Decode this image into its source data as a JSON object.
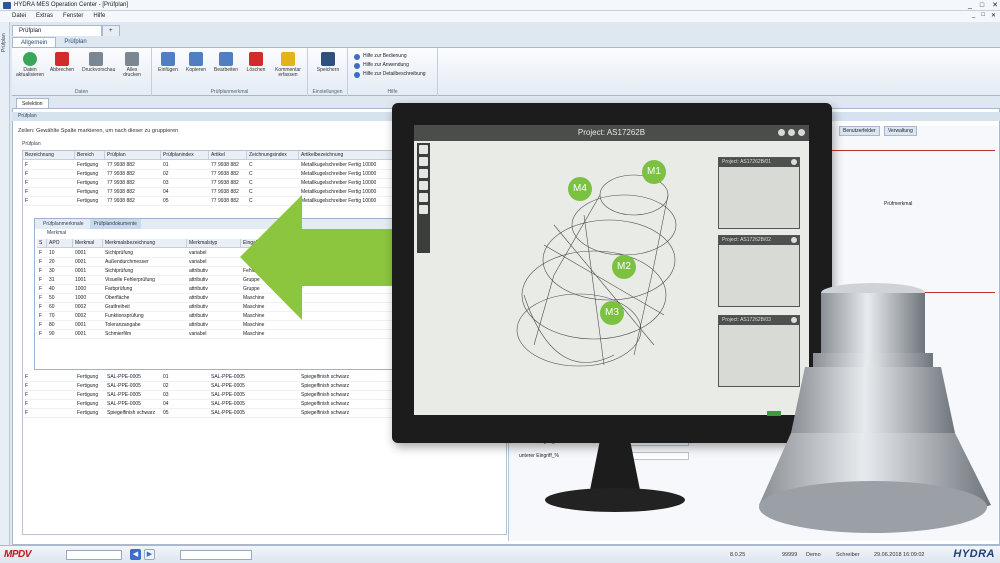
{
  "window": {
    "title": "HYDRA MES Operation Center - [Prüfplan]",
    "min": "_",
    "max": "□",
    "close": "✕"
  },
  "menu": [
    "Datei",
    "Extras",
    "Fenster",
    "Hilfe"
  ],
  "left_tab": "Prüfplan",
  "doc_tabs": [
    "Prüfplan",
    "+"
  ],
  "ribbon": {
    "tabs": [
      "Allgemein",
      "Prüfplan"
    ],
    "groups": [
      {
        "label": "Daten",
        "buttons": [
          "Daten aktualisieren",
          "Abbrechen",
          "Druckvorschau",
          "Alles drucken"
        ]
      },
      {
        "label": "Prüfplanmerkmal",
        "buttons": [
          "Einfügen",
          "Kopieren",
          "Bearbeiten",
          "Löschen",
          "Kommentar erfassen"
        ]
      },
      {
        "label": "Einstellungen",
        "buttons": [
          "Speichern"
        ]
      },
      {
        "label": "Hilfe",
        "links": [
          "Hilfe zur Bedienung",
          "Hilfe zur Anwendung",
          "Hilfe zur Detailbeschreibung"
        ]
      }
    ],
    "colors": {
      "refresh": "#3aa657",
      "cancel": "#d32b2b",
      "print": "#7b8693",
      "doc": "#4f7fc2",
      "yellow": "#e3b31b",
      "save": "#2f4f7f"
    }
  },
  "selection_tab": "Selektion",
  "section_bar": "Prüfplan",
  "hint": "Zeilen: Gewählte Spalte markieren, um nach dieser zu gruppieren",
  "table_caption": "Prüfplan",
  "columns": [
    "Bezeichnung",
    "Bereich",
    "Prüfplan",
    "Prüfplanindex",
    "Artikel",
    "Zeichnungsindex",
    "Artikelbezeichnung"
  ],
  "rows_top": [
    [
      "F",
      "Fertigung",
      "77 9938 882",
      "01",
      "77 9938 882",
      "C",
      "Metallkugelschreiber Fertig 10000"
    ],
    [
      "F",
      "Fertigung",
      "77 9938 882",
      "02",
      "77 9938 882",
      "C",
      "Metallkugelschreiber Fertig 10000"
    ],
    [
      "F",
      "Fertigung",
      "77 9938 882",
      "03",
      "77 9938 882",
      "C",
      "Metallkugelschreiber Fertig 10000"
    ],
    [
      "F",
      "Fertigung",
      "77 9938 882",
      "04",
      "77 9938 882",
      "C",
      "Metallkugelschreiber Fertig 10000"
    ],
    [
      "F",
      "Fertigung",
      "77 9938 882",
      "05",
      "77 9938 882",
      "C",
      "Metallkugelschreiber Fertig 10000"
    ]
  ],
  "sub_tabs": [
    "Prüfplanmerkmale",
    "Prüfplandokumente"
  ],
  "sub_caption": "Merkmal",
  "sub_columns": [
    "S",
    "APO",
    "Merkmal",
    "Merkmalsbezeichnung",
    "Merkmalstyp",
    "Eingabe"
  ],
  "sub_rows": [
    [
      "F",
      "10",
      "0001",
      "Sichtprüfung",
      "variabel",
      ""
    ],
    [
      "F",
      "20",
      "0001",
      "Außendurchmesser",
      "variabel",
      ""
    ],
    [
      "F",
      "30",
      "0001",
      "Sichtprüfung",
      "attributiv",
      "Fehlermerkmale"
    ],
    [
      "F",
      "31",
      "1001",
      "Visuelle Fehlerprüfung",
      "attributiv",
      "Gruppe"
    ],
    [
      "F",
      "40",
      "1000",
      "Farbprüfung",
      "attributiv",
      "Gruppe"
    ],
    [
      "F",
      "50",
      "1000",
      "Oberfläche",
      "attributiv",
      "Maschine"
    ],
    [
      "F",
      "60",
      "0002",
      "Gratfreiheit",
      "attributiv",
      "Maschine"
    ],
    [
      "F",
      "70",
      "0002",
      "Funktionsprüfung",
      "attributiv",
      "Maschine"
    ],
    [
      "F",
      "80",
      "0001",
      "Toleranzangabe",
      "attributiv",
      "Maschine"
    ],
    [
      "F",
      "90",
      "0001",
      "Schmierfilm",
      "variabel",
      "Maschine"
    ]
  ],
  "rows_bottom": [
    [
      "F",
      "Fertigung",
      "SAL-PPE-0005",
      "01",
      "SAL-PPE-0005",
      "",
      "Spiegelfinish schwarz"
    ],
    [
      "F",
      "Fertigung",
      "SAL-PPE-0005",
      "02",
      "SAL-PPE-0005",
      "",
      "Spiegelfinish schwarz"
    ],
    [
      "F",
      "Fertigung",
      "SAL-PPE-0005",
      "03",
      "SAL-PPE-0005",
      "",
      "Spiegelfinish schwarz"
    ],
    [
      "F",
      "Fertigung",
      "SAL-PPE-0005",
      "04",
      "SAL-PPE-0005",
      "",
      "Spiegelfinish schwarz"
    ],
    [
      "F",
      "Fertigung",
      "Spiegelfinish schwarz",
      "05",
      "SAL-PPE-0005",
      "",
      "Spiegelfinish schwarz"
    ]
  ],
  "right_panel": {
    "tabs": [
      "Benutzerfelder",
      "Verwaltung"
    ],
    "fields": [
      "unterer Eingriff_%",
      "unterer Eingriff_%"
    ],
    "side_label": "Prüfmerkmal"
  },
  "status": {
    "brand": "MPDV",
    "left_value": "",
    "nav_prev": "◀",
    "nav_next": "▶",
    "version": "8.0.25",
    "count": "99999",
    "user": "Demo",
    "role": "Schreiber",
    "datetime": "29.06.2018 16:09:02",
    "product": "HYDRA"
  },
  "monitor": {
    "project_title": "Project: AS17262B",
    "thumbs": [
      "Project: AS17262B/01",
      "Project: AS17262B/02",
      "Project: AS17262B/03"
    ],
    "markers": [
      "M1",
      "M2",
      "M3",
      "M4"
    ],
    "marker_color": "#7cc142"
  },
  "overlay_arrow_color": "#8cc63f"
}
